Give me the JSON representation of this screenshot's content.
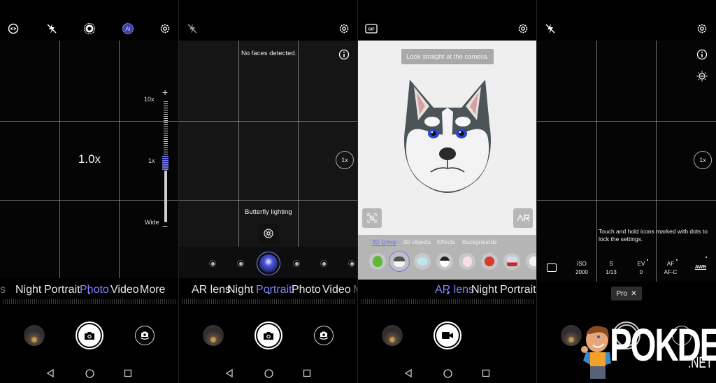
{
  "panels": {
    "photo": {
      "top_icons": [
        "motion-photo-icon",
        "flash-off-icon",
        "aperture-icon",
        "ai-icon",
        "settings-icon"
      ],
      "zoom_value": "1.0x",
      "zoom_slider": {
        "max_label": "10x",
        "mid_label": "1x",
        "min_label": "Wide",
        "plus": "+",
        "minus": "−",
        "current": "1x"
      },
      "modes": [
        "s",
        "Night",
        "Portrait",
        "Photo",
        "Video",
        "More"
      ],
      "active_mode": "Photo",
      "shutter": "camera-icon"
    },
    "portrait": {
      "top_icons": [
        "flash-off-icon",
        "settings-icon"
      ],
      "face_status": "No faces detected.",
      "zoom_button": "1x",
      "lighting_label": "Butterfly lighting",
      "lighting_options_count": 7,
      "lighting_selected_index": 2,
      "modes": [
        "AR lens",
        "Night",
        "Portrait",
        "Photo",
        "Video",
        "M"
      ],
      "active_mode": "Portrait",
      "shutter": "camera-icon"
    },
    "ar_lens": {
      "top_icons": [
        "gif-icon",
        "settings-icon"
      ],
      "hint": "Look straight at the camera.",
      "ar_button": "AR",
      "tabs": [
        "3D Qmoji",
        "3D objects",
        "Effects",
        "Backgrounds"
      ],
      "active_tab": "3D Qmoji",
      "qmoji": [
        "dinosaur",
        "husky",
        "bird",
        "penguin",
        "rabbit",
        "tomato",
        "robot",
        "cat"
      ],
      "selected_qmoji": "husky",
      "modes": [
        "AR lens",
        "Night",
        "Portrait"
      ],
      "active_mode": "AR lens",
      "shutter": "video-camera-icon"
    },
    "pro": {
      "top_icons": [
        "flash-off-icon",
        "settings-icon",
        "info-icon",
        "brightness-icon"
      ],
      "zoom_button": "1x",
      "lock_hint": "Touch and hold icons marked with dots to lock the settings.",
      "settings": [
        {
          "label": "ISO",
          "value": "2000",
          "locked": false
        },
        {
          "label": "S",
          "value": "1/13",
          "locked": false
        },
        {
          "label": "EV",
          "value": "0",
          "locked": true
        },
        {
          "label": "AF",
          "value": "AF-C",
          "locked": true
        },
        {
          "label": "AWB",
          "value": "",
          "locked": true
        }
      ],
      "mode_chip": "Pro",
      "chip_close": "✕"
    }
  },
  "watermark": {
    "brand": "POKDE",
    "suffix": ".NET"
  },
  "colors": {
    "accent": "#7f86ff",
    "ar_background": "#efefef",
    "tray": "#b5b5b5"
  }
}
